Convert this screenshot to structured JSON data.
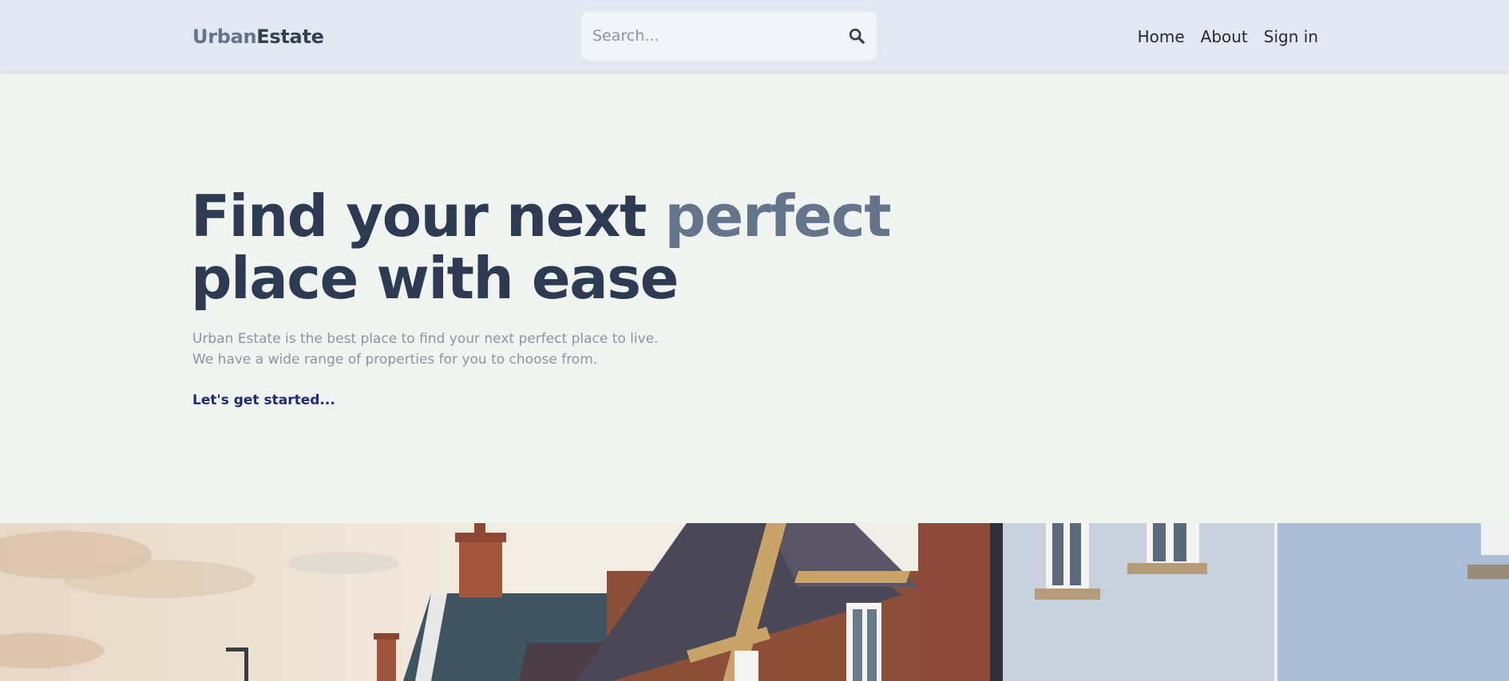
{
  "header": {
    "logo_part1": "Urban",
    "logo_part2": "Estate",
    "search_placeholder": "Search...",
    "search_icon": "search-icon",
    "nav": [
      "Home",
      "About",
      "Sign in"
    ]
  },
  "hero": {
    "title_line1": "Find your next ",
    "title_accent": "perfect",
    "title_line2": "place with ease",
    "subtitle_line1": "Urban Estate is the best place to find your next perfect place to live.",
    "subtitle_line2": "We have a wide range of properties for you to choose from.",
    "cta_label": "Let's get started..."
  },
  "colors": {
    "header_bg": "#e2e8f0",
    "page_bg": "#f0f5f1",
    "text_dark": "#2d3b52",
    "accent": "#64748b",
    "cta": "#1e2a7a"
  }
}
